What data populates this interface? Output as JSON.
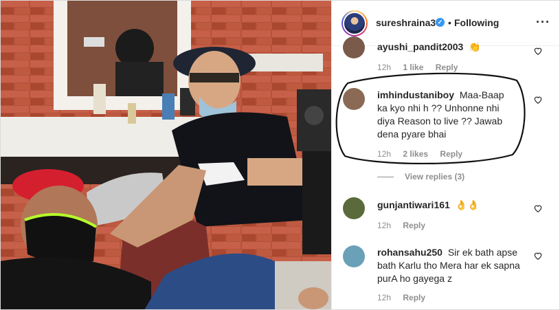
{
  "header": {
    "username": "sureshraina3",
    "verified_glyph": "✓",
    "separator": "•",
    "follow_status": "Following",
    "more_glyph": "···"
  },
  "comments": [
    {
      "username": "ayushi_pandit2003",
      "text": "👏",
      "time": "12h",
      "likes": "1 like",
      "reply": "Reply",
      "avatar_color": "#7a5a4a"
    },
    {
      "username": "imhindustaniboy",
      "text": "Maa-Baap ka kyo nhi h ?? Unhonne nhi diya Reason to live ?? Jawab dena pyare bhai",
      "time": "12h",
      "likes": "2 likes",
      "reply": "Reply",
      "view_replies": "View replies (3)",
      "avatar_color": "#8a6a55"
    },
    {
      "username": "gunjantiwari161",
      "text": "👌👌",
      "time": "12h",
      "reply": "Reply",
      "avatar_color": "#5a6a3a"
    },
    {
      "username": "rohansahu250",
      "text": "Sir ek bath apse bath Karlu tho Mera har ek sapna purA ho gayega z",
      "time": "12h",
      "reply": "Reply",
      "avatar_color": "#6aa0b8"
    }
  ],
  "icons": {
    "heart": "heart-icon",
    "more": "more-options-icon",
    "verified": "verified-badge-icon"
  },
  "colors": {
    "meta_gray": "#8e8e8e",
    "verified_blue": "#3897f0",
    "text": "#262626"
  }
}
